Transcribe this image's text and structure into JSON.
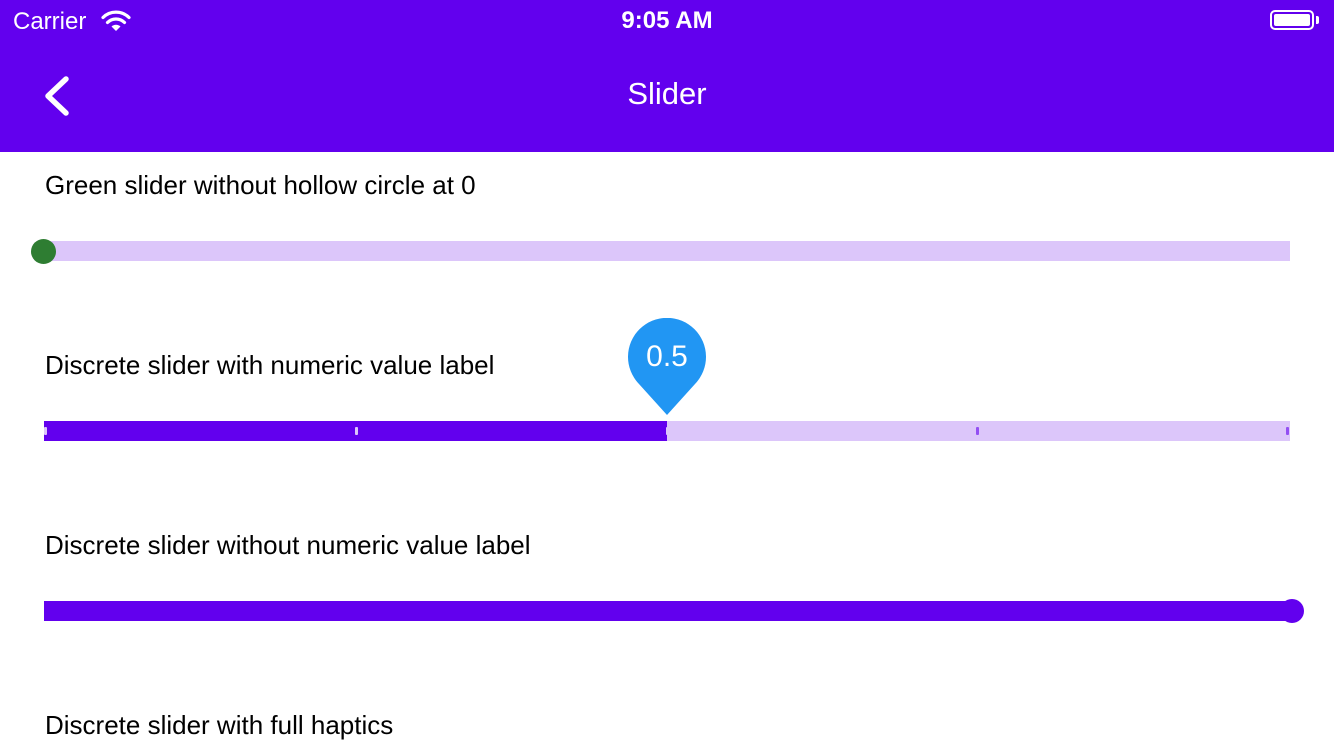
{
  "status_bar": {
    "carrier": "Carrier",
    "time": "9:05 AM"
  },
  "app_bar": {
    "title": "Slider",
    "back_icon": "chevron-left-icon"
  },
  "colors": {
    "primary": "#6200EE",
    "track_inactive": "#DCC6FA",
    "green_thumb": "#2E7D32",
    "indicator": "#2196F3"
  },
  "sliders": [
    {
      "label": "Green slider without hollow circle at 0",
      "value": 0,
      "discrete": false
    },
    {
      "label": "Discrete slider with numeric value label",
      "value": 0.5,
      "divisions": 4,
      "value_label": "0.5"
    },
    {
      "label": "Discrete slider without numeric value label",
      "value": 1.0,
      "discrete": true
    },
    {
      "label": "Discrete slider with full haptics"
    }
  ]
}
